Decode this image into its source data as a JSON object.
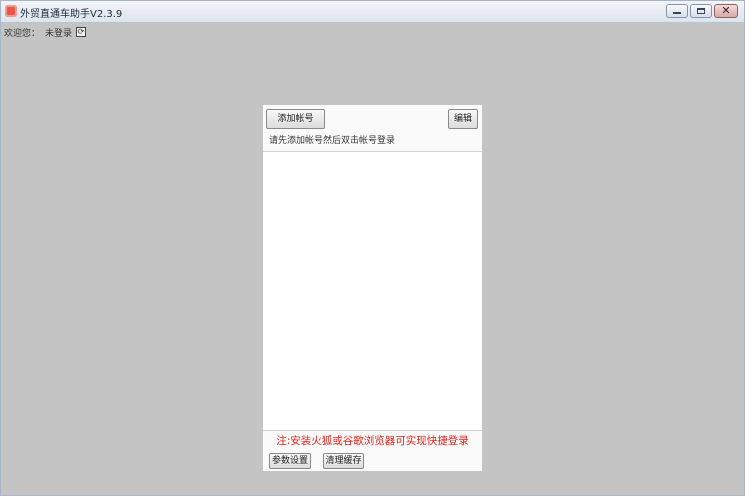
{
  "window": {
    "title": "外贸直通车助手V2.3.9",
    "controls": {
      "minimize": "minimize",
      "maximize": "maximize",
      "close": "✕"
    }
  },
  "status": {
    "welcome_label": "欢迎您：",
    "login_status": "未登录",
    "refresh_glyph": "⟳"
  },
  "panel": {
    "add_account_label": "添加帐号",
    "edit_label": "编辑",
    "hint": "请先添加帐号然后双击帐号登录",
    "accounts": [],
    "note": "注:安装火狐或谷歌浏览器可实现快捷登录",
    "settings_label": "参数设置",
    "clear_cache_label": "清理缓存"
  },
  "colors": {
    "background": "#c4c4c4",
    "note_text": "#e0241d"
  },
  "icons": [
    "app-icon",
    "refresh-icon",
    "minimize-icon",
    "maximize-icon",
    "close-icon"
  ]
}
